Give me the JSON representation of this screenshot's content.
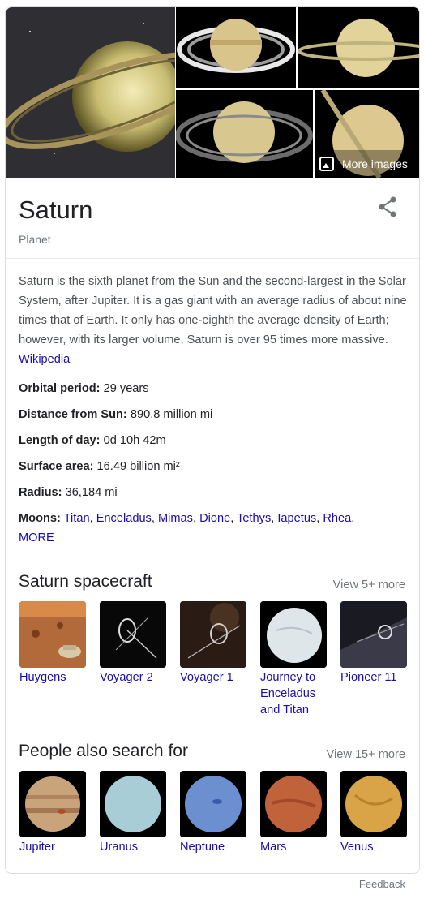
{
  "entity": {
    "title": "Saturn",
    "subtitle": "Planet"
  },
  "images": {
    "more_images_label": "More images"
  },
  "description": {
    "text": "Saturn is the sixth planet from the Sun and the second-largest in the Solar System, after Jupiter. It is a gas giant with an average radius of about nine times that of Earth. It only has one-eighth the average density of Earth; however, with its larger volume, Saturn is over 95 times more massive. ",
    "source": "Wikipedia"
  },
  "facts": [
    {
      "label": "Orbital period:",
      "value": "29 years"
    },
    {
      "label": "Distance from Sun:",
      "value": "890.8 million mi"
    },
    {
      "label": "Length of day:",
      "value": "0d 10h 42m"
    },
    {
      "label": "Surface area:",
      "value": "16.49 billion mi²"
    },
    {
      "label": "Radius:",
      "value": "36,184 mi"
    }
  ],
  "moons": {
    "label": "Moons:",
    "items": [
      "Titan",
      "Enceladus",
      "Mimas",
      "Dione",
      "Tethys",
      "Iapetus",
      "Rhea"
    ],
    "more": "MORE"
  },
  "spacecraft": {
    "title": "Saturn spacecraft",
    "view_more": "View 5+ more",
    "items": [
      {
        "name": "Huygens"
      },
      {
        "name": "Voyager 2"
      },
      {
        "name": "Voyager 1"
      },
      {
        "name": "Journey to Enceladus and Titan"
      },
      {
        "name": "Pioneer 11"
      }
    ]
  },
  "people_also_search": {
    "title": "People also search for",
    "view_more": "View 15+ more",
    "items": [
      {
        "name": "Jupiter",
        "color": "#c9a47a"
      },
      {
        "name": "Uranus",
        "color": "#a9cdd6"
      },
      {
        "name": "Neptune",
        "color": "#6c8fd0"
      },
      {
        "name": "Mars",
        "color": "#c0623a"
      },
      {
        "name": "Venus",
        "color": "#d9a347"
      }
    ]
  },
  "footer": {
    "feedback": "Feedback"
  }
}
